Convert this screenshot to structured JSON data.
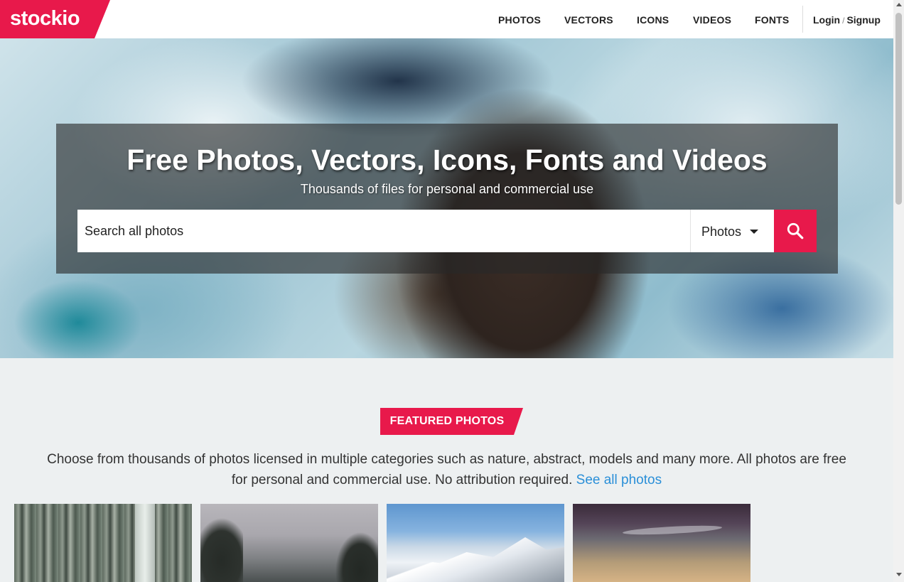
{
  "brand": {
    "name": "stockio",
    "accent": "#e8194b"
  },
  "nav": {
    "items": [
      {
        "label": "PHOTOS"
      },
      {
        "label": "VECTORS"
      },
      {
        "label": "ICONS"
      },
      {
        "label": "VIDEOS"
      },
      {
        "label": "FONTS"
      }
    ],
    "login_label": "Login",
    "separator": "/",
    "signup_label": "Signup"
  },
  "hero": {
    "title": "Free Photos, Vectors, Icons, Fonts and Videos",
    "subtitle": "Thousands of files for personal and commercial use",
    "search_placeholder": "Search all photos",
    "search_type": "Photos",
    "search_icon": "search-icon"
  },
  "featured": {
    "badge": "FEATURED PHOTOS",
    "description": "Choose from thousands of photos licensed in multiple categories such as nature, abstract, models and many more. All photos are free for personal and commercial use. No attribution required.",
    "link": "See all photos"
  },
  "colors": {
    "link": "#2a8fd8",
    "page_bg": "#edf0f1"
  }
}
